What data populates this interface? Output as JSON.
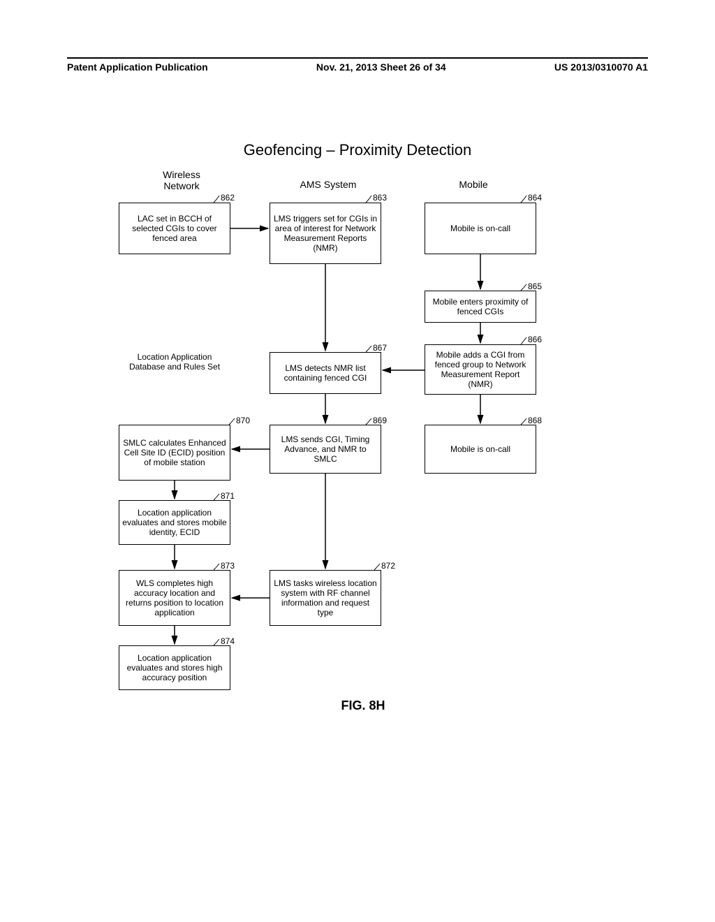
{
  "header": {
    "left": "Patent Application Publication",
    "center": "Nov. 21, 2013  Sheet 26 of 34",
    "right": "US 2013/0310070 A1"
  },
  "title": "Geofencing – Proximity Detection",
  "columns": {
    "wireless": "Wireless\nNetwork",
    "ams": "AMS System",
    "mobile": "Mobile"
  },
  "refs": {
    "r862": "862",
    "r863": "863",
    "r864": "864",
    "r865": "865",
    "r866": "866",
    "r867": "867",
    "r868": "868",
    "r869": "869",
    "r870": "870",
    "r871": "871",
    "r872": "872",
    "r873": "873",
    "r874": "874"
  },
  "boxes": {
    "b862": "LAC set in BCCH of selected CGIs to cover fenced area",
    "b863": "LMS triggers set for CGIs in area of interest for Network Measurement Reports (NMR)",
    "b864": "Mobile is on-call",
    "b865": "Mobile enters proximity of fenced CGIs",
    "b866": "Mobile adds a CGI from fenced group to Network Measurement Report (NMR)",
    "b867": "LMS detects NMR list containing fenced CGI",
    "b868": "Mobile is on-call",
    "b869": "LMS sends CGI, Timing Advance, and NMR to SMLC",
    "b870": "SMLC calculates Enhanced Cell Site ID (ECID) position of mobile station",
    "b871": "Location application evaluates and stores mobile identity, ECID",
    "b872": "LMS tasks wireless location system with RF channel information and request type",
    "b873": "WLS completes high accuracy location and returns position to location application",
    "b874": "Location application evaluates and stores high accuracy position",
    "locapp": "Location Application Database and Rules Set"
  },
  "figure_label": "FIG. 8H"
}
